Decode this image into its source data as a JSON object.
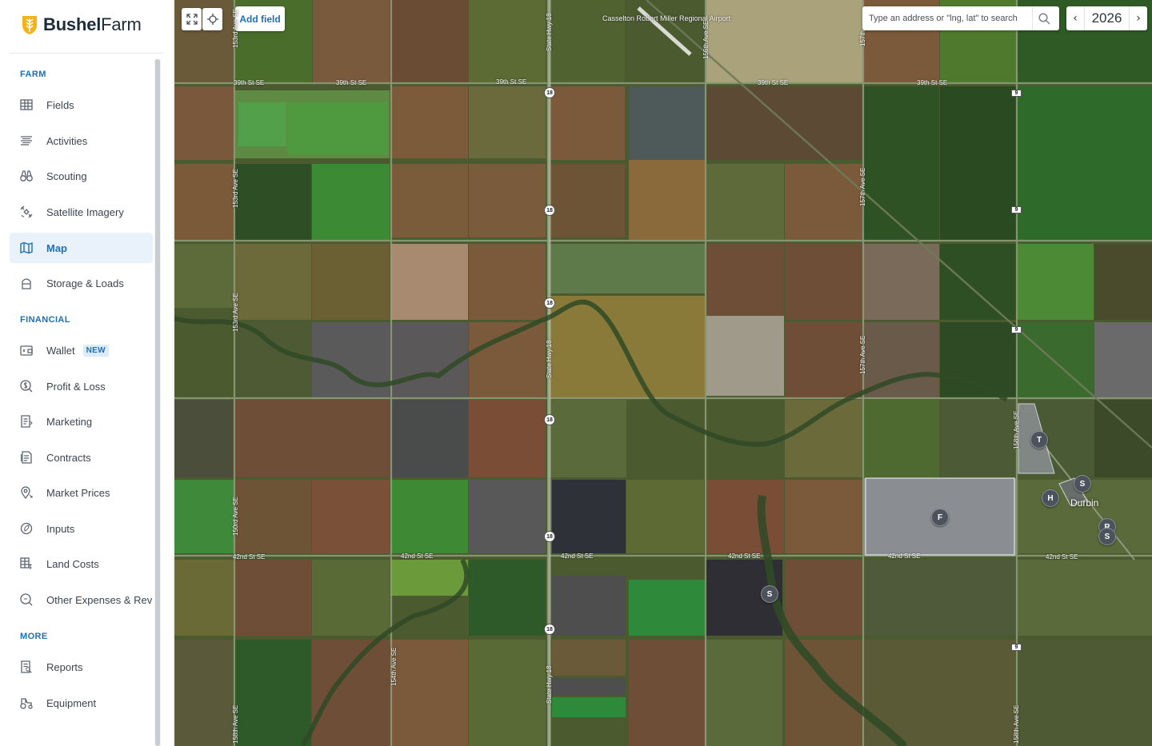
{
  "brand": {
    "name_bold": "Bushel",
    "name_light": "Farm",
    "logo_icon": "bushel-wheat-logo-icon",
    "color": "#f5b21a"
  },
  "nav": {
    "sections": [
      {
        "title": "FARM",
        "items": [
          {
            "label": "Fields",
            "icon": "fields-grid-icon"
          },
          {
            "label": "Activities",
            "icon": "activities-list-icon"
          },
          {
            "label": "Scouting",
            "icon": "binoculars-icon"
          },
          {
            "label": "Satellite Imagery",
            "icon": "satellite-icon"
          },
          {
            "label": "Map",
            "icon": "map-icon",
            "active": true
          },
          {
            "label": "Storage & Loads",
            "icon": "silo-icon"
          }
        ]
      },
      {
        "title": "FINANCIAL",
        "items": [
          {
            "label": "Wallet",
            "icon": "wallet-icon",
            "badge": "NEW"
          },
          {
            "label": "Profit & Loss",
            "icon": "profit-loss-icon"
          },
          {
            "label": "Marketing",
            "icon": "marketing-icon"
          },
          {
            "label": "Contracts",
            "icon": "contracts-icon"
          },
          {
            "label": "Market Prices",
            "icon": "market-prices-icon"
          },
          {
            "label": "Inputs",
            "icon": "inputs-icon"
          },
          {
            "label": "Land Costs",
            "icon": "land-costs-icon"
          },
          {
            "label": "Other Expenses & Rev",
            "icon": "other-expenses-icon"
          }
        ]
      },
      {
        "title": "MORE",
        "items": [
          {
            "label": "Reports",
            "icon": "reports-icon"
          },
          {
            "label": "Equipment",
            "icon": "tractor-icon"
          }
        ]
      }
    ]
  },
  "map": {
    "add_field_label": "Add field",
    "search_placeholder": "Type an address or \"lng, lat\" to search",
    "year": "2026",
    "year_prev": "‹",
    "year_next": "›",
    "airport_label": "Casselton Robert Miller Regional Airport",
    "town_label": "Durbin",
    "road_labels": {
      "r1": "39th St SE",
      "r2": "39th St SE",
      "r3": "39th St SE",
      "r4": "39th St SE",
      "r5": "39th St SE",
      "r6": "42nd St SE",
      "r7": "42nd St SE",
      "r8": "42nd St SE",
      "r9": "42nd St SE",
      "r10": "42nd St SE",
      "r11": "42nd St SE",
      "v1": "153rd Ave SE",
      "v2": "153rd Ave SE",
      "v3": "153rd Ave SE",
      "v4": "150rd Ave SE",
      "v5": "State Hwy 18",
      "v6": "State Hwy 18",
      "v7": "State Hwy 18",
      "v8": "156th Ave SE",
      "v9": "157th Ave SE",
      "v10": "157th Ave SE",
      "v11": "157th",
      "v12": "154th Ave SE",
      "v13": "158th Ave SE",
      "v14": "158th Ave SE",
      "v15": "158th Ave SE"
    },
    "shields": {
      "hwy18": "18",
      "route9": "9"
    },
    "markers": [
      {
        "letter": "T",
        "kind": "map-marker"
      },
      {
        "letter": "S",
        "kind": "map-marker"
      },
      {
        "letter": "H",
        "kind": "map-marker"
      },
      {
        "letter": "F",
        "kind": "field-marker"
      },
      {
        "letter": "R",
        "kind": "map-marker"
      },
      {
        "letter": "S",
        "kind": "map-marker"
      },
      {
        "letter": "S",
        "kind": "map-marker"
      }
    ]
  }
}
